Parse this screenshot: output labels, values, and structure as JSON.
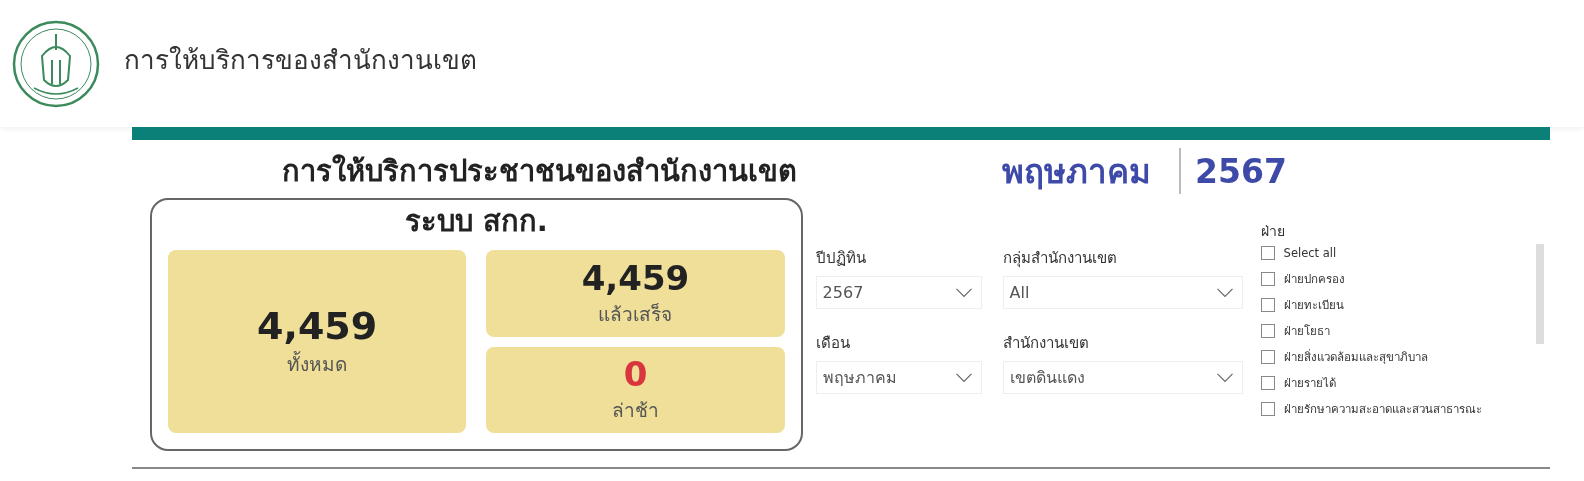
{
  "header": {
    "title": "การให้บริการของสำนักงานเขต"
  },
  "report": {
    "title": "การให้บริการประชาชนของสำนักงานเขต",
    "month": "พฤษภาคม",
    "year": "2567"
  },
  "summary": {
    "title": "ระบบ สกก.",
    "tiles": [
      {
        "kind": "total",
        "value": "4,459",
        "label": "ทั้งหมด"
      },
      {
        "kind": "done",
        "value": "4,459",
        "label": "แล้วเสร็จ"
      },
      {
        "kind": "late",
        "value": "0",
        "label": "ล่าช้า"
      }
    ]
  },
  "filters": [
    {
      "label": "ปีปฏิทิน",
      "value": "2567"
    },
    {
      "label": "กลุ่มสำนักงานเขต",
      "value": "All"
    },
    {
      "label": "เดือน",
      "value": "พฤษภาคม"
    },
    {
      "label": "สำนักงานเขต",
      "value": "เขตดินแดง"
    }
  ],
  "division": {
    "title": "ฝ่าย",
    "items": [
      {
        "label": "Select all",
        "checked": false
      },
      {
        "label": "ฝ่ายปกครอง",
        "checked": false
      },
      {
        "label": "ฝ่ายทะเบียน",
        "checked": false
      },
      {
        "label": "ฝ่ายโยธา",
        "checked": false
      },
      {
        "label": "ฝ่ายสิ่งแวดล้อมและสุขาภิบาล",
        "checked": false
      },
      {
        "label": "ฝ่ายรายได้",
        "checked": false
      },
      {
        "label": "ฝ่ายรักษาความสะอาดและสวนสาธารณะ",
        "checked": false
      }
    ]
  }
}
